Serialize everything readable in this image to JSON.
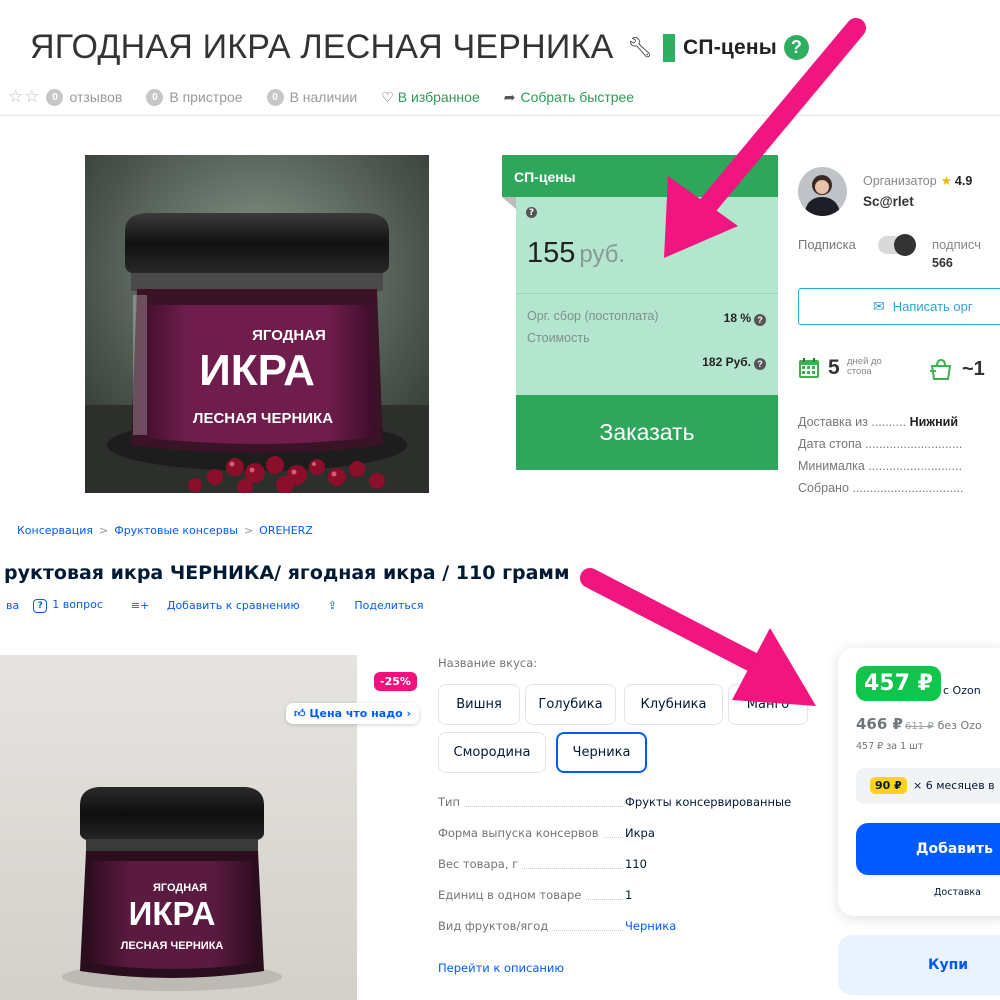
{
  "sp": {
    "title": "ЯГОДНАЯ ИКРА ЛЕСНАЯ ЧЕРНИКА",
    "sp_label": "СП-цены",
    "reviews_count": "0",
    "reviews_label": "отзывов",
    "attached_count": "0",
    "attached_label": "В пристрое",
    "stock_count": "0",
    "stock_label": "В наличии",
    "favorite_label": "В избранное",
    "fast_label": "Собрать быстрее",
    "product_image": {
      "jar_line1": "ЯГОДНАЯ",
      "jar_line2": "ИКРА",
      "jar_line3": "ЛЕСНАЯ ЧЕРНИКА"
    },
    "pricebox": {
      "header": "СП-цены",
      "price": "155",
      "currency": "руб.",
      "fee_label": "Орг. сбор (постоплата)",
      "fee_value": "18 %",
      "cost_label": "Стоимость",
      "cost_value": "182 Руб.",
      "order_button": "Заказать"
    },
    "organizer": {
      "label": "Организатор",
      "rating": "4.9",
      "name": "Sc@rlet",
      "subscription_label": "Подписка",
      "subscribers_label": "подписч",
      "subscribers_value": "566",
      "write_button": "Написать орг",
      "days_number": "5",
      "days_label": "дней до стопа",
      "approx": "~1",
      "rows": [
        {
          "label": "Доставка из",
          "value": "Нижний"
        },
        {
          "label": "Дата стопа",
          "value": ""
        },
        {
          "label": "Минималка",
          "value": ""
        },
        {
          "label": "Собрано",
          "value": ""
        }
      ]
    }
  },
  "ozon": {
    "breadcrumbs": [
      "Консервация",
      "Фруктовые консервы",
      "OREHERZ"
    ],
    "title": "руктовая икра ЧЕРНИКА/ ягодная икра / 110 грамм",
    "actions": {
      "reviews": "ва",
      "question": "1 вопрос",
      "compare": "Добавить к сравнению",
      "share": "Поделиться"
    },
    "product_image": {
      "jar_line1": "ЯГОДНАЯ",
      "jar_line2": "ИКРА",
      "jar_line3": "ЛЕСНАЯ ЧЕРНИКА"
    },
    "discount_badge": "-25%",
    "good_price_label": "Цена что надо",
    "flavor_label": "Название вкуса:",
    "flavors": [
      "Вишня",
      "Голубика",
      "Клубника",
      "Манго",
      "Смородина",
      "Черника"
    ],
    "selected_flavor": "Черника",
    "specs": [
      {
        "key": "Тип",
        "value": "Фрукты консервированные",
        "link": false
      },
      {
        "key": "Форма выпуска консервов",
        "value": "Икра",
        "link": false
      },
      {
        "key": "Вес товара, г",
        "value": "110",
        "link": false
      },
      {
        "key": "Единиц в одном товаре",
        "value": "1",
        "link": false
      },
      {
        "key": "Вид фруктов/ягод",
        "value": "Черника",
        "link": true
      }
    ],
    "to_description": "Перейти к описанию",
    "card": {
      "ozon_price": "457 ₽",
      "ozon_price_note": "c Ozon",
      "price": "466 ₽",
      "old_price": "611 ₽",
      "price_note": "без Ozo",
      "unit_price": "457 ₽ за 1 шт",
      "installment_amount": "90 ₽",
      "installment_text": "× 6 месяцев в",
      "add_button": "Добавить",
      "delivery": "Доставка",
      "buy_button": "Купи"
    }
  },
  "colors": {
    "sp_green": "#2ea75c",
    "sp_mint": "#b4e6cf",
    "ozon_blue": "#005bff",
    "ozon_green": "#10c44c",
    "arrow_pink": "#f0157f"
  }
}
